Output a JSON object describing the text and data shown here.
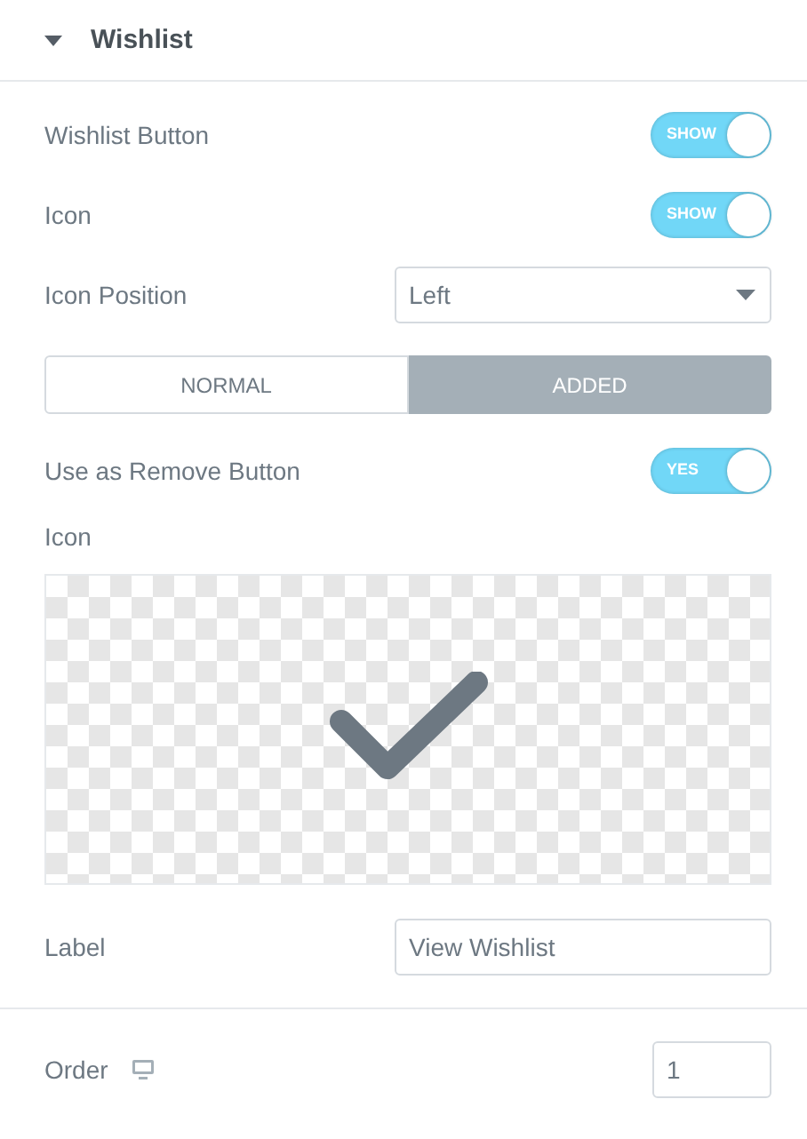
{
  "section": {
    "title": "Wishlist",
    "expanded": true
  },
  "controls": [
    {
      "kind": "switch",
      "label": "Wishlist Button",
      "on": true,
      "switch_text": "SHOW"
    },
    {
      "kind": "switch",
      "label": "Icon",
      "on": true,
      "switch_text": "SHOW"
    },
    {
      "kind": "select",
      "label": "Icon Position",
      "value": "Left"
    },
    {
      "kind": "tabs",
      "tabs": [
        {
          "label": "NORMAL",
          "selected": false
        },
        {
          "label": "ADDED",
          "selected": true
        }
      ]
    },
    {
      "kind": "switch",
      "label": "Use as Remove Button",
      "on": true,
      "switch_text": "YES"
    },
    {
      "kind": "media",
      "label": "Icon"
    },
    {
      "kind": "text",
      "label": "Label",
      "value": "View Wishlist"
    },
    {
      "kind": "divider"
    },
    {
      "kind": "number",
      "label": "Order",
      "value": "1"
    }
  ]
}
